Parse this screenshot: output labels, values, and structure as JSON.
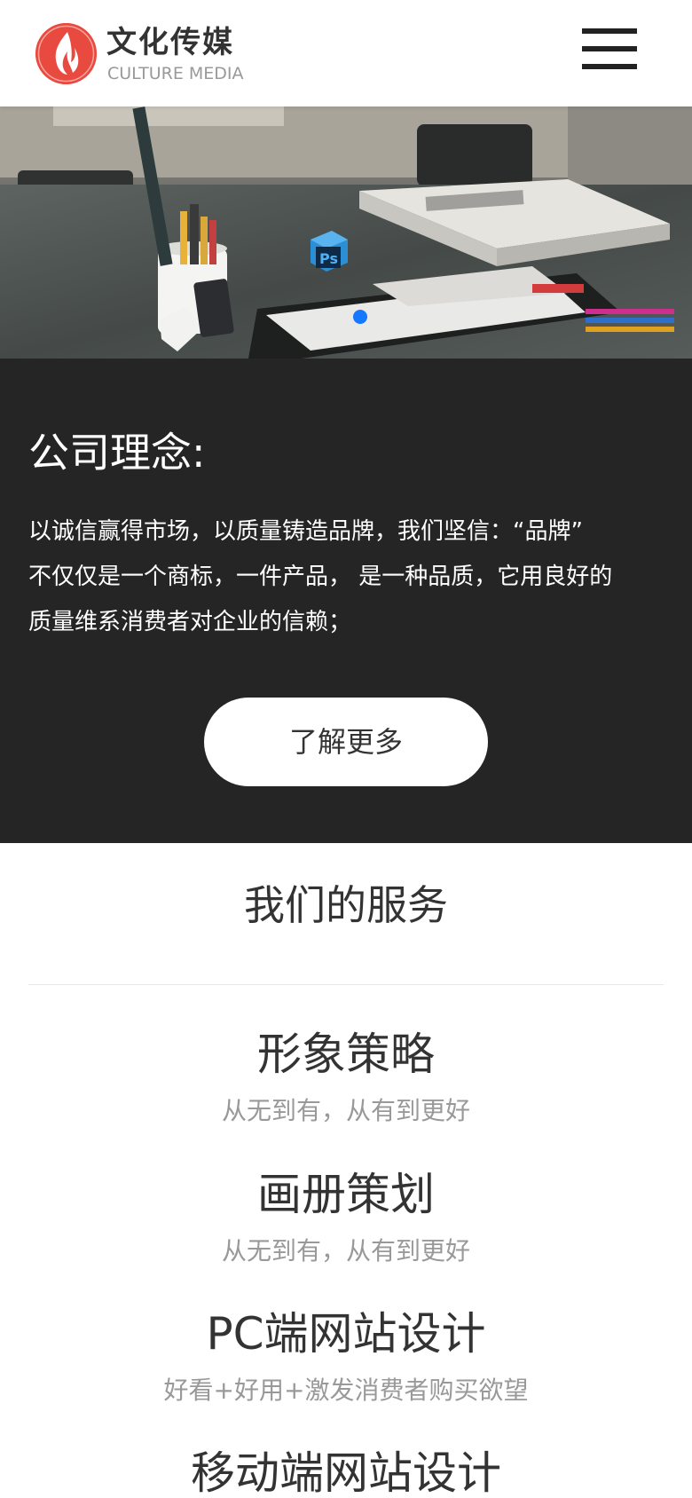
{
  "header": {
    "brand_cn": "文化传媒",
    "brand_en": "CULTURE MEDIA",
    "logo_icon": "flame-icon",
    "menu_icon": "hamburger-menu-icon",
    "logo_color": "#e94a3f"
  },
  "banner": {
    "badge_text": "Ps",
    "slide_indicator_color": "#1677ff"
  },
  "philosophy": {
    "title": "公司理念:",
    "lines": [
      "以诚信赢得市场，以质量铸造品牌，我们坚信：“品牌”",
      "不仅仅是一个商标，一件产品， 是一种品质，它用良好的",
      "质量维系消费者对企业的信赖；"
    ],
    "more_label": "了解更多",
    "background": "#252525"
  },
  "services": {
    "title": "我们的服务",
    "items": [
      {
        "name": "形象策略",
        "desc": "从无到有，从有到更好"
      },
      {
        "name": "画册策划",
        "desc": "从无到有，从有到更好"
      },
      {
        "name": "PC端网站设计",
        "desc": "好看+好用+激发消费者购买欲望"
      },
      {
        "name": "移动端网站设计",
        "desc": ""
      }
    ]
  }
}
